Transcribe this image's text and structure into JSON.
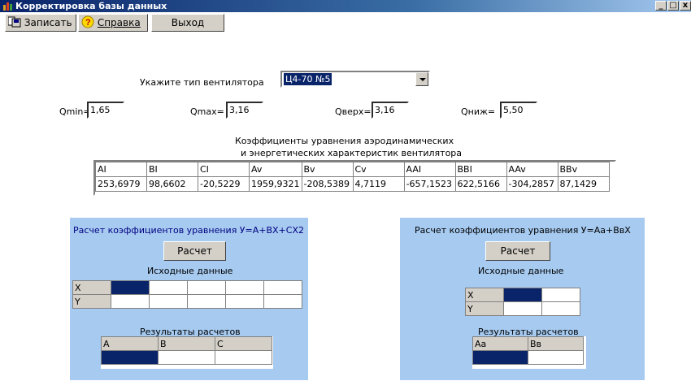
{
  "window": {
    "title": "Корректировка базы данных",
    "controls": [
      "_",
      "□",
      "x"
    ]
  },
  "toolbar": {
    "save_label": "Записать",
    "help_label": "Справка",
    "exit_label": "Выход"
  },
  "form": {
    "fan_type_label": "Укажите тип вентилятора",
    "fan_type_value": "Ц4-70 №5",
    "qmin_label": "Qmin=",
    "qmin_value": "1,65",
    "qmax_label": "Qmax=",
    "qmax_value": "3,16",
    "qverh_label": "Qверх=",
    "qverh_value": "3,16",
    "qniz_label": "Qниж=",
    "qniz_value": "5,50"
  },
  "coef": {
    "title_line1": "Коэффициенты уравнения аэродинамических",
    "title_line2": "и энергетических характеристик вентилятора",
    "headers": [
      "AI",
      "BI",
      "CI",
      "Av",
      "Bv",
      "Cv",
      "AAI",
      "BBI",
      "AAv",
      "BBv"
    ],
    "values": [
      "253,6979",
      "98,6602",
      "-20,5229",
      "1959,9321",
      "-208,5389",
      "4,7119",
      "-657,1523",
      "622,5166",
      "-304,2857",
      "87,1429"
    ]
  },
  "left_panel": {
    "title": "Расчет коэффициентов уравнения  У=А+ВХ+СХ2",
    "calc_button": "Расчет",
    "source_label": "Исходные данные",
    "rows": [
      "X",
      "Y"
    ],
    "results_label": "Результаты расчетов",
    "result_headers": [
      "A",
      "B",
      "C"
    ]
  },
  "right_panel": {
    "title": "Расчет коэффициентов уравнения У=Аа+ВвХ",
    "calc_button": "Расчет",
    "source_label": "Исходные данные",
    "rows": [
      "X",
      "Y"
    ],
    "results_label": "Результаты расчетов",
    "result_headers": [
      "Аа",
      "Вв"
    ]
  },
  "colors": {
    "titlebar": "#0a246a",
    "panel": "#a6caf0",
    "selection": "#0a246a"
  }
}
